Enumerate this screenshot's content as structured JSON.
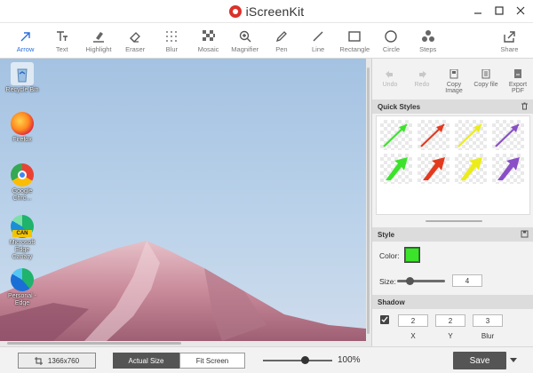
{
  "app": {
    "title": "iScreenKit",
    "brand_color": "#d9322b"
  },
  "window_controls": [
    "minimize-icon",
    "maximize-icon",
    "close-icon"
  ],
  "toolbar": {
    "active": "Arrow",
    "accent": "#2a6fdb",
    "tools": [
      {
        "label": "Arrow",
        "icon": "arrow-icon"
      },
      {
        "label": "Text",
        "icon": "text-icon"
      },
      {
        "label": "Highlight",
        "icon": "highlight-icon"
      },
      {
        "label": "Eraser",
        "icon": "eraser-icon"
      },
      {
        "label": "Blur",
        "icon": "blur-icon"
      },
      {
        "label": "Mosaic",
        "icon": "mosaic-icon"
      },
      {
        "label": "Magnifier",
        "icon": "magnifier-icon"
      },
      {
        "label": "Pen",
        "icon": "pen-icon"
      },
      {
        "label": "Line",
        "icon": "line-icon"
      },
      {
        "label": "Rectangle",
        "icon": "rectangle-icon"
      },
      {
        "label": "Circle",
        "icon": "circle-icon"
      },
      {
        "label": "Steps",
        "icon": "steps-icon"
      },
      {
        "label": "Share",
        "icon": "share-icon"
      }
    ]
  },
  "desktop": {
    "icons": [
      {
        "label": "Recycle Bin",
        "icon": "recycle-bin-icon"
      },
      {
        "label": "Firefox",
        "icon": "firefox-icon"
      },
      {
        "label": "Google Chro...",
        "icon": "chrome-icon"
      },
      {
        "label": "Microsoft Edge Canary",
        "icon": "edge-canary-icon",
        "badge": "CAN"
      },
      {
        "label": "Personal - Edge",
        "icon": "edge-icon"
      }
    ]
  },
  "actions": [
    {
      "label": "Undo",
      "icon": "undo-icon",
      "enabled": false
    },
    {
      "label": "Redo",
      "icon": "redo-icon",
      "enabled": false
    },
    {
      "label": "Copy Image",
      "icon": "copy-image-icon",
      "enabled": true
    },
    {
      "label": "Copy file",
      "icon": "copy-file-icon",
      "enabled": true
    },
    {
      "label": "Export PDF",
      "icon": "export-pdf-icon",
      "enabled": true
    }
  ],
  "quick_styles": {
    "title": "Quick Styles",
    "colors": [
      "#3be32a",
      "#e33a1f",
      "#ecec1a",
      "#8a4fc6"
    ]
  },
  "style": {
    "title": "Style",
    "color_label": "Color:",
    "color_value": "#3be32a",
    "size_label": "Size:",
    "size_value": "4",
    "size_fraction": 0.25
  },
  "shadow": {
    "title": "Shadow",
    "enabled": true,
    "x_value": "2",
    "y_value": "2",
    "blur_value": "3",
    "x_label": "X",
    "y_label": "Y",
    "blur_label": "Blur"
  },
  "bottom": {
    "dimensions": "1366x760",
    "actual_size": "Actual Size",
    "fit_screen": "Fit Screen",
    "zoom": "100%",
    "zoom_fraction": 0.6,
    "save": "Save"
  }
}
